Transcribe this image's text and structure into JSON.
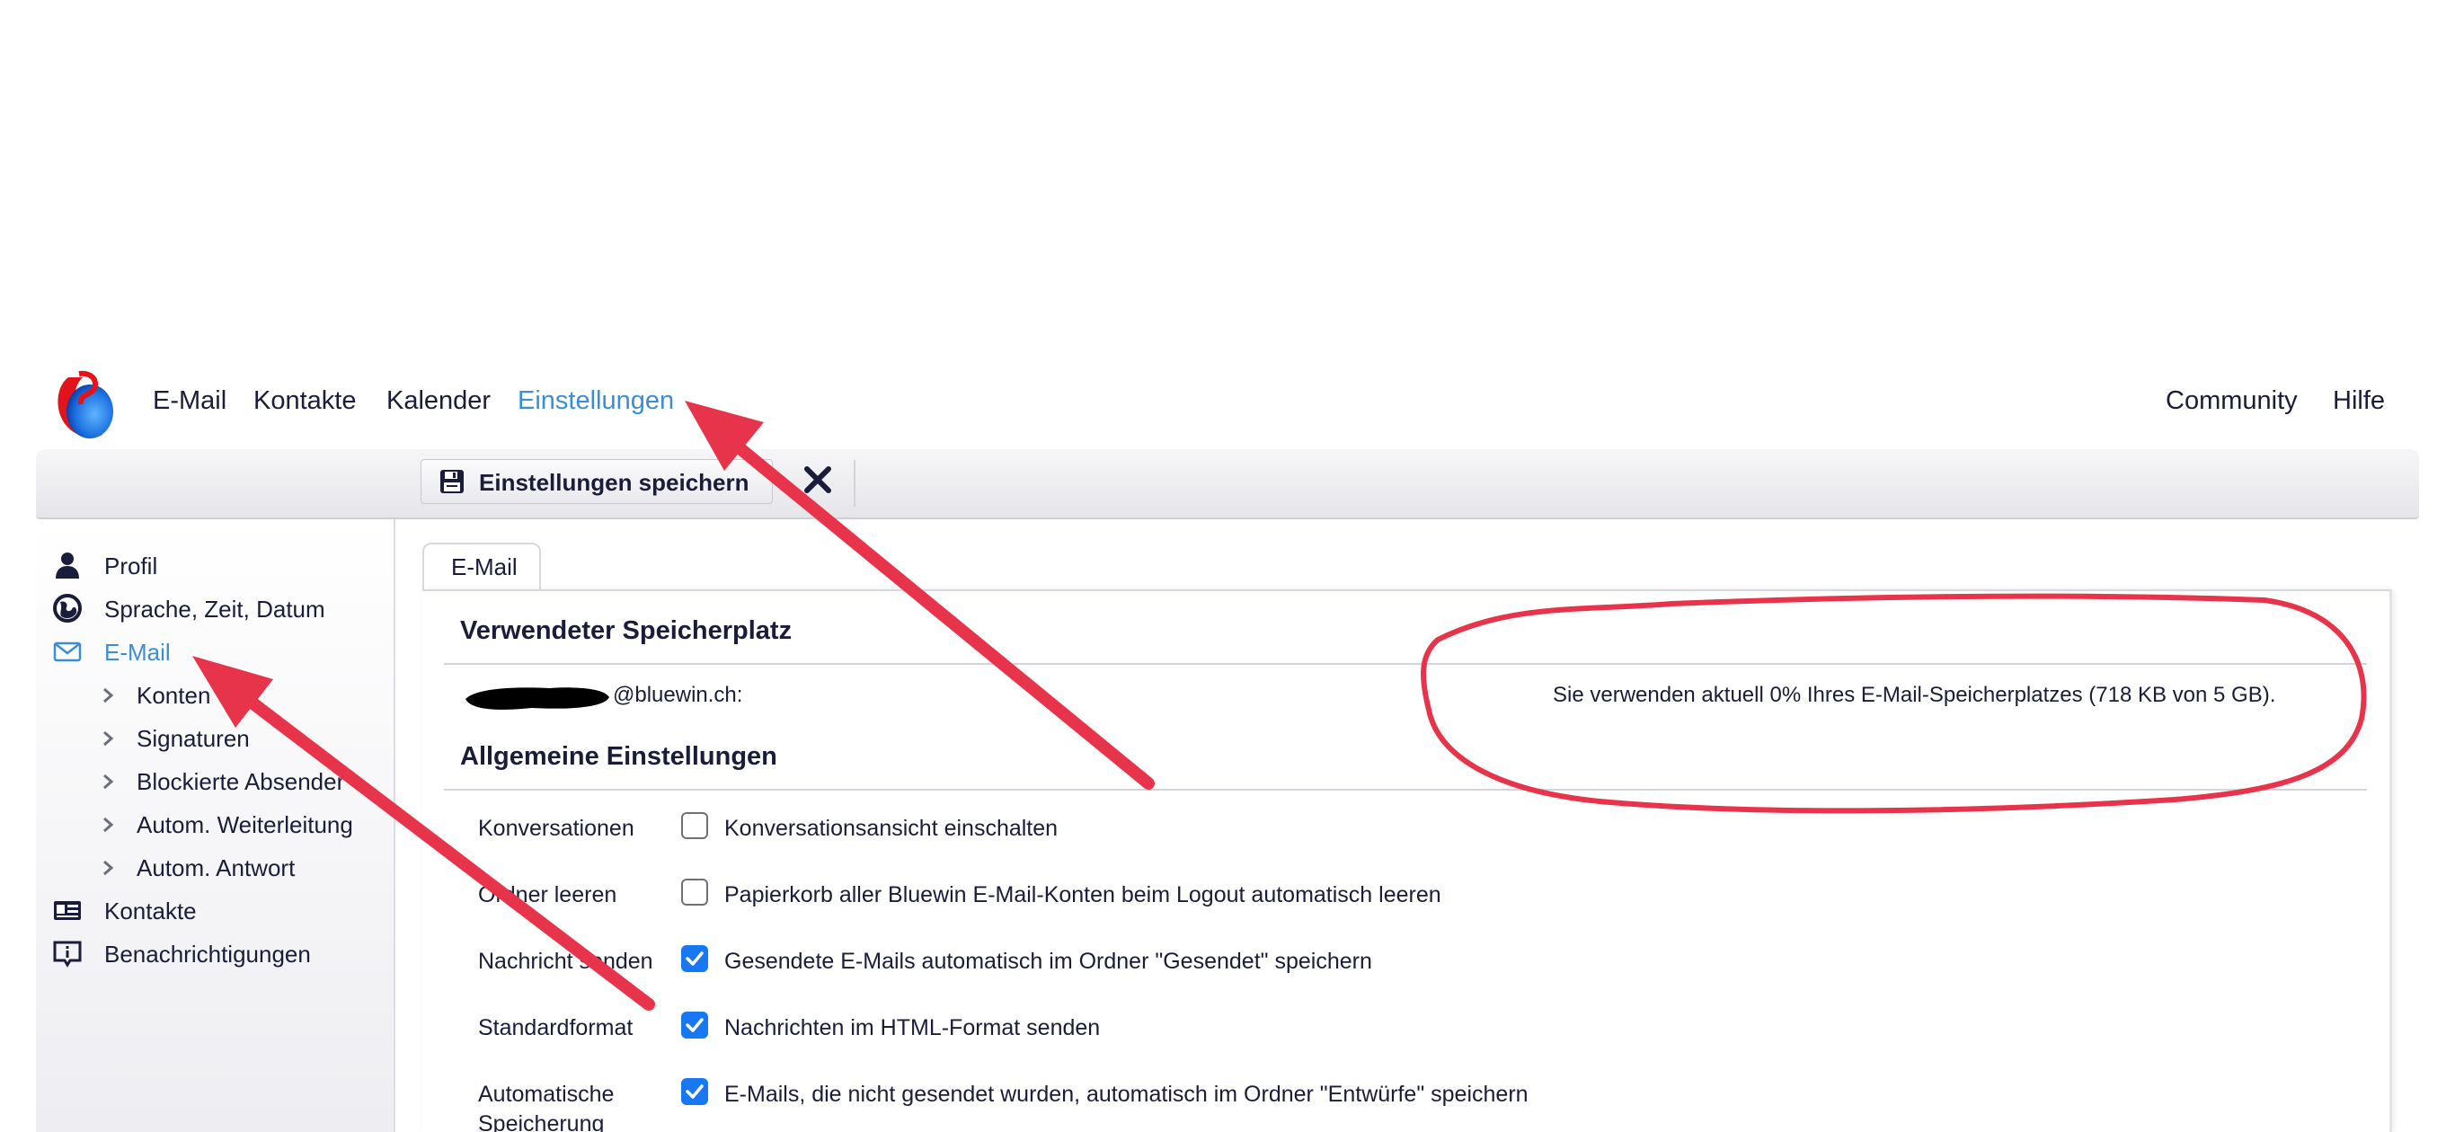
{
  "nav": {
    "left": [
      "E-Mail",
      "Kontakte",
      "Kalender",
      "Einstellungen"
    ],
    "active": "Einstellungen",
    "right": [
      "Community",
      "Hilfe"
    ]
  },
  "toolbar": {
    "save_label": "Einstellungen speichern"
  },
  "sidebar": {
    "items": [
      {
        "label": "Profil",
        "icon": "person-icon"
      },
      {
        "label": "Sprache, Zeit, Datum",
        "icon": "globe-icon"
      },
      {
        "label": "E-Mail",
        "icon": "envelope-icon",
        "active": true
      },
      {
        "label": "Kontakte",
        "icon": "contact-card-icon"
      },
      {
        "label": "Benachrichtigungen",
        "icon": "notification-icon"
      }
    ],
    "sub_items": [
      "Konten",
      "Signaturen",
      "Blockierte Absender",
      "Autom. Weiterleitung",
      "Autom. Antwort"
    ]
  },
  "tab": {
    "label": "E-Mail"
  },
  "storage": {
    "title": "Verwendeter Speicherplatz",
    "account": "@bluewin.ch:",
    "usage": "Sie verwenden aktuell 0% Ihres E-Mail-Speicherplatzes (718 KB von 5 GB)."
  },
  "general": {
    "title": "Allgemeine Einstellungen",
    "rows": [
      {
        "label": "Konversationen",
        "text": "Konversationsansicht einschalten",
        "checked": false
      },
      {
        "label": "Ordner leeren",
        "text": "Papierkorb aller Bluewin E-Mail-Konten beim Logout automatisch leeren",
        "checked": false
      },
      {
        "label": "Nachricht senden",
        "text": "Gesendete E-Mails automatisch im Ordner \"Gesendet\" speichern",
        "checked": true
      },
      {
        "label": "Standardformat",
        "text": "Nachrichten im HTML-Format senden",
        "checked": true
      },
      {
        "label": "Automatische Speicherung",
        "text": "E-Mails, die nicht gesendet wurden, automatisch im Ordner \"Entwürfe\" speichern",
        "checked": true
      }
    ]
  },
  "colors": {
    "accent": "#3b8ed6",
    "text": "#1a1d3a",
    "checkbox_on": "#1877f2",
    "annotation_red": "#e8344a"
  }
}
